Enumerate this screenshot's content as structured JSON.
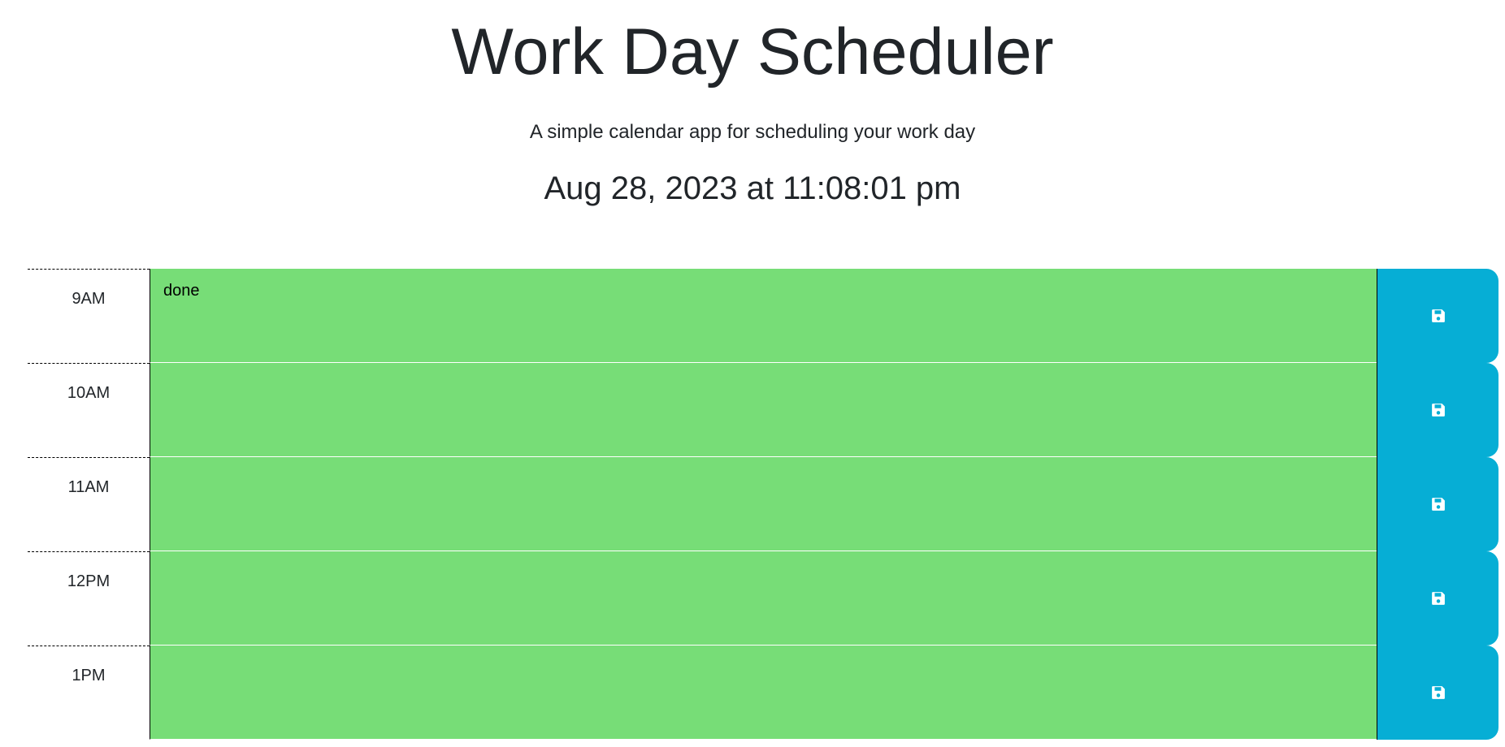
{
  "header": {
    "title": "Work Day Scheduler",
    "subtitle": "A simple calendar app for scheduling your work day",
    "current_day": "Aug 28, 2023 at 11:08:01 pm"
  },
  "colors": {
    "present_block": "#77dd77",
    "save_button": "#06aed5"
  },
  "time_blocks": [
    {
      "hour": "9AM",
      "text": "done",
      "save_icon": "floppy-disk-icon"
    },
    {
      "hour": "10AM",
      "text": "",
      "save_icon": "floppy-disk-icon"
    },
    {
      "hour": "11AM",
      "text": "",
      "save_icon": "floppy-disk-icon"
    },
    {
      "hour": "12PM",
      "text": "",
      "save_icon": "floppy-disk-icon"
    },
    {
      "hour": "1PM",
      "text": "",
      "save_icon": "floppy-disk-icon"
    }
  ]
}
